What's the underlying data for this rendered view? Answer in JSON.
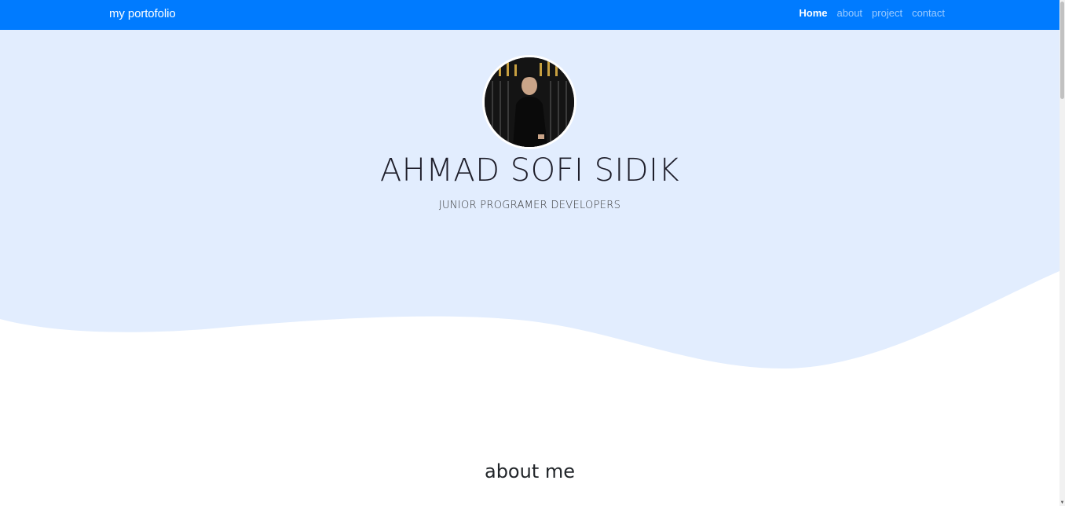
{
  "navbar": {
    "brand": "my portofolio",
    "links": [
      {
        "label": "Home",
        "active": true
      },
      {
        "label": "about",
        "active": false
      },
      {
        "label": "project",
        "active": false
      },
      {
        "label": "contact",
        "active": false
      }
    ],
    "background": "#007bff"
  },
  "hero": {
    "name": "AHMAD SOFI SIDIK",
    "role": "JUNIOR PROGRAMER DEVELOPERS",
    "background": "#e2edfe",
    "avatar": "profile-photo"
  },
  "about": {
    "title": "about me"
  }
}
